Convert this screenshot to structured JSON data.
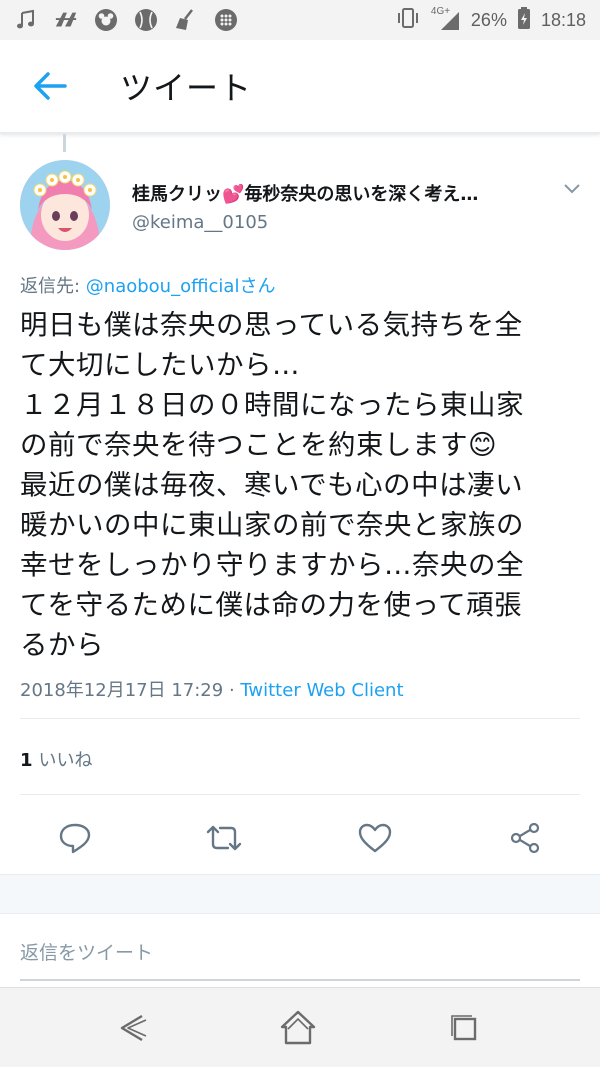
{
  "status_bar": {
    "network": "4G+",
    "battery_percent": "26%",
    "time": "18:18",
    "left_icons": [
      "music-note-icon",
      "app-logo-icon",
      "mickey-icon",
      "baseball-icon",
      "broom-icon",
      "dots-icon"
    ]
  },
  "header": {
    "title": "ツイート"
  },
  "tweet": {
    "display_name": "桂馬クリッ💕毎秒奈央の思いを深く考え…",
    "handle": "@keima__0105",
    "reply_label": "返信先: ",
    "reply_mention": "@naobou_officialさん",
    "text_lines": [
      "明日も僕は奈央の思っている気持ちを全",
      "て大切にしたいから…",
      "１２月１８日の０時間になったら東山家",
      "の前で奈央を待つことを約束します😊",
      "最近の僕は毎夜、寒いでも心の中は凄い",
      "暖かいの中に東山家の前で奈央と家族の",
      "幸せをしっかり守りますから…奈央の全",
      "てを守るために僕は命の力を使って頑張",
      "るから"
    ],
    "timestamp": "2018年12月17日 17:29",
    "separator": " · ",
    "client": "Twitter Web Client",
    "like_count": "1",
    "like_label": "いいね"
  },
  "reply_placeholder": "返信をツイート",
  "colors": {
    "accent": "#1da1f2",
    "secondary_text": "#657786",
    "divider": "#e6ecf0"
  }
}
